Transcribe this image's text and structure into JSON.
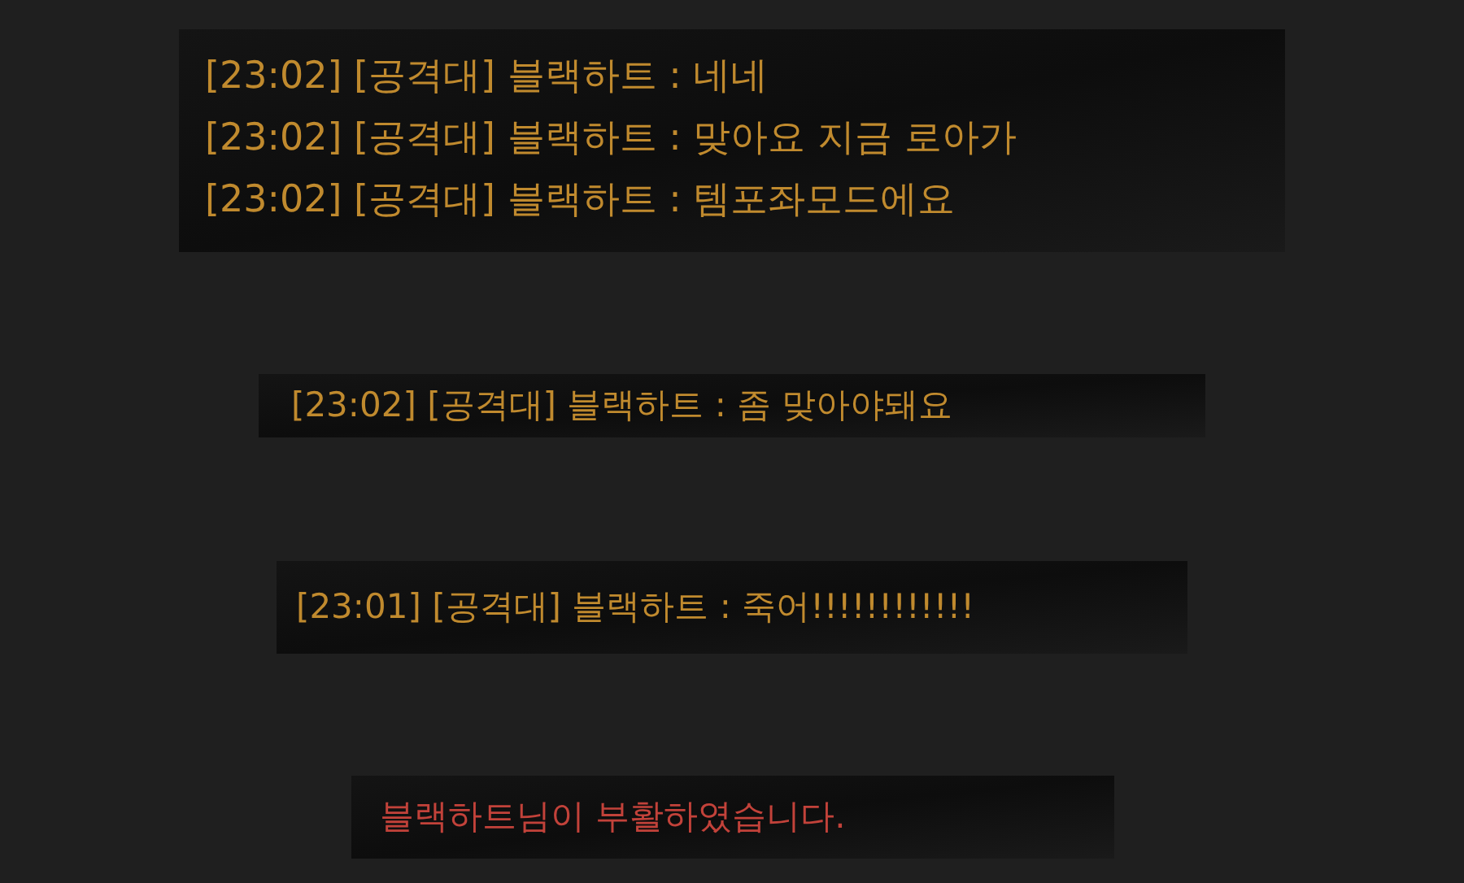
{
  "clips": [
    {
      "lines": [
        {
          "kind": "chat",
          "text": "[23:02] [공격대] 블랙하트 : 네네"
        },
        {
          "kind": "chat",
          "text": "[23:02] [공격대] 블랙하트 : 맞아요 지금 로아가"
        },
        {
          "kind": "chat",
          "text": "[23:02] [공격대] 블랙하트 : 템포좌모드에요"
        }
      ]
    },
    {
      "lines": [
        {
          "kind": "chat",
          "text": "[23:02] [공격대] 블랙하트 : 좀 맞아야돼요"
        }
      ]
    },
    {
      "lines": [
        {
          "kind": "chat",
          "text": "[23:01] [공격대] 블랙하트 : 죽어!!!!!!!!!!!!"
        }
      ]
    },
    {
      "lines": [
        {
          "kind": "system",
          "text": "블랙하트님이 부활하였습니다."
        }
      ]
    }
  ]
}
